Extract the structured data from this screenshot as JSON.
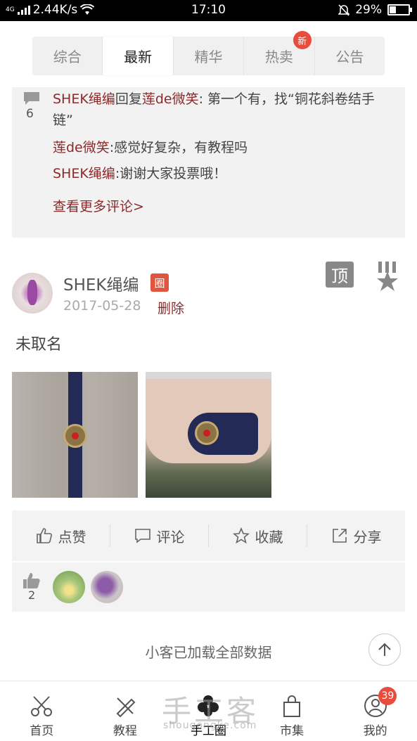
{
  "status_bar": {
    "signal": "4G",
    "speed": "2.44K/s",
    "time": "17:10",
    "battery": "29%"
  },
  "tabs": [
    {
      "label": "综合",
      "active": false
    },
    {
      "label": "最新",
      "active": true
    },
    {
      "label": "精华",
      "active": false
    },
    {
      "label": "热卖",
      "active": false,
      "badge": "新"
    },
    {
      "label": "公告",
      "active": false
    }
  ],
  "comments": {
    "count": "6",
    "items": [
      {
        "user": "SHEK绳编",
        "reply_word": "回复",
        "reply_to": "莲de微笑",
        "text": ": 第一个有，找“铜花斜卷结手链”"
      },
      {
        "user": "莲de微笑",
        "text": ":感觉好复杂，有教程吗"
      },
      {
        "user": "SHEK绳编",
        "text": ":谢谢大家投票哦！"
      }
    ],
    "more_label": "查看更多评论>"
  },
  "post": {
    "username": "SHEK绳编",
    "circle_badge": "圈",
    "date": "2017-05-28",
    "delete_label": "删除",
    "top_label": "顶",
    "title": "未取名"
  },
  "actions": {
    "like": "点赞",
    "comment": "评论",
    "favorite": "收藏",
    "share": "分享"
  },
  "likes": {
    "count": "2"
  },
  "loaded_text": "小客已加载全部数据",
  "bottom_nav": [
    {
      "label": "首页",
      "icon": "scissors-icon"
    },
    {
      "label": "教程",
      "icon": "tools-icon"
    },
    {
      "label": "手工圈",
      "icon": "flower-icon",
      "active": true
    },
    {
      "label": "市集",
      "icon": "bag-icon"
    },
    {
      "label": "我的",
      "icon": "user-icon",
      "badge": "39"
    }
  ],
  "watermark": {
    "main": "手工客",
    "sub": "shougongke.com"
  },
  "colors": {
    "username_red": "#8b2a2a",
    "badge_red": "#e74c3c"
  }
}
